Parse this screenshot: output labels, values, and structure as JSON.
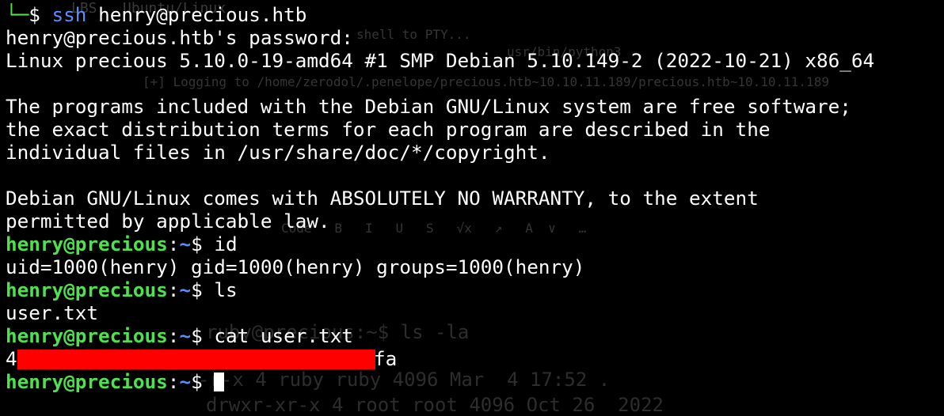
{
  "colors": {
    "background": "#000000",
    "prompt_user_host": "#4ee34e",
    "prompt_path": "#5c8cff",
    "redaction": "#ff0000"
  },
  "ssh": {
    "corner": "└─",
    "prompt_symbol": "$",
    "command": "ssh",
    "target": "henry@precious.htb"
  },
  "login": {
    "password_prompt": "henry@precious.htb's password:",
    "uname": "Linux precious 5.10.0-19-amd64 #1 SMP Debian 5.10.149-2 (2022-10-21) x86_64"
  },
  "motd": {
    "line1": "The programs included with the Debian GNU/Linux system are free software;",
    "line2": "the exact distribution terms for each program are described in the",
    "line3": "individual files in /usr/share/doc/*/copyright.",
    "line4": "Debian GNU/Linux comes with ABSOLUTELY NO WARRANTY, to the extent",
    "line5": "permitted by applicable law."
  },
  "prompt": {
    "user_host": "henry@precious",
    "separator": ":",
    "path": "~",
    "symbol": "$"
  },
  "session": [
    {
      "command": "id",
      "output": "uid=1000(henry) gid=1000(henry) groups=1000(henry)"
    },
    {
      "command": "ls",
      "output": "user.txt"
    },
    {
      "command": "cat user.txt",
      "output_start": "4",
      "output_end": "fa"
    }
  ],
  "background_ghost": {
    "line1": "LBS   Ubuntu/Linux",
    "line2": "shell to PTY...",
    "line3": "usr/bin/python3",
    "line4": "[+] Logging to /home/zerodol/.penelope/precious.htb~10.10.11.189/precious.htb~10.10.11.189",
    "line5": "ruby@precious:~$ ls -la",
    "line6": "-r-x 4 ruby ruby 4096 Mar  4 17:52 .",
    "line7": "drwxr-xr-x 4 root root 4096 Oct 26  2022",
    "toolbar": "Code   B   I   U   S   √x   ↗   A  ∨   …"
  }
}
